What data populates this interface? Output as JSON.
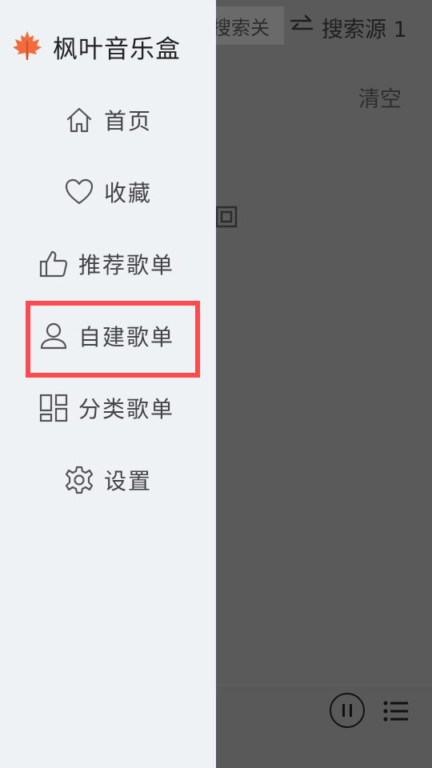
{
  "app": {
    "title": "枫叶音乐盒"
  },
  "menu": {
    "items": [
      {
        "label": "首页",
        "icon": "home-icon"
      },
      {
        "label": "收藏",
        "icon": "heart-icon"
      },
      {
        "label": "推荐歌单",
        "icon": "thumbs-up-icon"
      },
      {
        "label": "自建歌单",
        "icon": "user-icon"
      },
      {
        "label": "分类歌单",
        "icon": "grid-icon"
      },
      {
        "label": "设置",
        "icon": "gear-icon"
      }
    ],
    "highlighted_index": 3
  },
  "background": {
    "search_placeholder": "搜索关",
    "source_label": "搜索源 1",
    "clear_label": "清空"
  },
  "colors": {
    "drawer_bg": "#eef2f5",
    "overlay_bg": "#5a5a5a",
    "highlight": "#ff4a4e",
    "maple_leaf": "#f26b3a"
  }
}
